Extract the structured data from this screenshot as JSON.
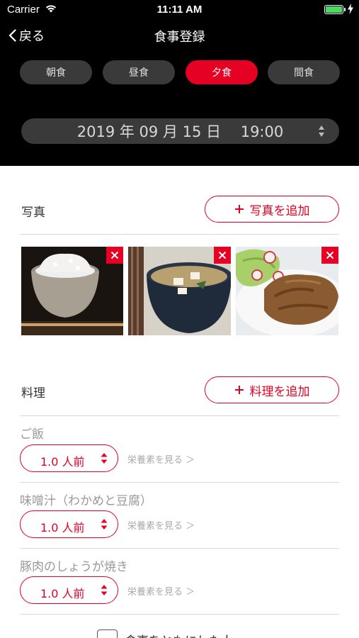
{
  "status_bar": {
    "carrier": "Carrier",
    "time": "11:11 AM"
  },
  "nav": {
    "back_label": "戻る",
    "title": "食事登録"
  },
  "meal_tabs": [
    {
      "label": "朝食",
      "active": false
    },
    {
      "label": "昼食",
      "active": false
    },
    {
      "label": "夕食",
      "active": true
    },
    {
      "label": "間食",
      "active": false
    }
  ],
  "date_picker": {
    "value": "2019 年 09 月 15 日　 19:00"
  },
  "photos": {
    "label": "写真",
    "add_label": "写真を追加",
    "items": [
      {
        "subject": "rice-bowl"
      },
      {
        "subject": "miso-soup"
      },
      {
        "subject": "ginger-pork"
      }
    ]
  },
  "dishes": {
    "label": "料理",
    "add_label": "料理を追加",
    "nutrition_link": "栄養素を見る ＞",
    "items": [
      {
        "name": "ご飯",
        "portion": "1.0 人前"
      },
      {
        "name": "味噌汁（わかめと豆腐）",
        "portion": "1.0 人前"
      },
      {
        "name": "豚肉のしょうが焼き",
        "portion": "1.0 人前"
      }
    ]
  },
  "bottom": {
    "checkbox_text": "食事をともにした人"
  },
  "colors": {
    "accent": "#e60024",
    "header_bg": "#000000",
    "pill_bg": "#3a3a3a",
    "battery": "#4cd964"
  }
}
